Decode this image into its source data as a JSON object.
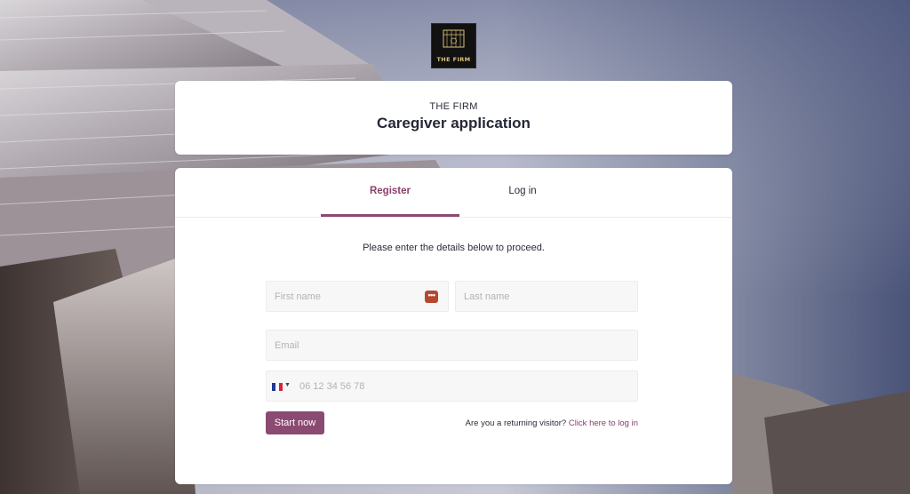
{
  "logo": {
    "text": "THE FIRM"
  },
  "header": {
    "company": "THE FIRM",
    "title": "Caregiver application"
  },
  "tabs": [
    {
      "label": "Register",
      "active": true
    },
    {
      "label": "Log in",
      "active": false
    }
  ],
  "form": {
    "instructions": "Please enter the details below to proceed.",
    "first_name": {
      "placeholder": "First name",
      "value": ""
    },
    "last_name": {
      "placeholder": "Last name",
      "value": ""
    },
    "email": {
      "placeholder": "Email",
      "value": ""
    },
    "phone": {
      "placeholder": "06 12 34 56 78",
      "value": "",
      "country_flag": "france-flag-icon"
    },
    "password_manager_icon": "password-manager-icon",
    "submit_label": "Start now",
    "returning_text": "Are you a returning visitor?",
    "returning_link": "Click here to log in"
  },
  "colors": {
    "accent": "#8b4a72",
    "accent_text": "#8b3f6a",
    "field_bg": "#f7f7f7",
    "password_icon": "#b5472f"
  }
}
